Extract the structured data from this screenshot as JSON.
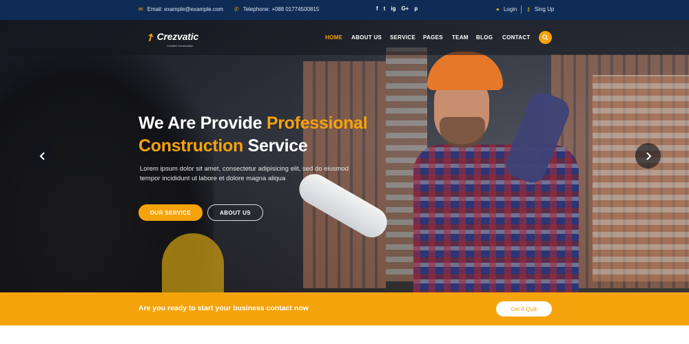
{
  "topbar": {
    "email": "Email: example@example.com",
    "phone": "Telephone: +088 01774500815",
    "social": [
      "f",
      "t",
      "ig",
      "G+",
      "p"
    ],
    "login": "Login",
    "signup": "Sing Up"
  },
  "brand": {
    "name": "Crezvatic",
    "tagline": "Creative Construction"
  },
  "nav": {
    "items": [
      "HOME",
      "ABOUT US",
      "SERVICE",
      "PAGES",
      "TEAM",
      "BLOG",
      "CONTACT"
    ],
    "active": "HOME"
  },
  "hero": {
    "title_part1": "We Are Provide ",
    "title_accent1": "Professional",
    "title_accent2": "Construction",
    "title_part2": " Service",
    "lead_line1": "Lorem ipsum dolor sit amet, consectetur adipisicing elit, sed do eiusmod",
    "lead_line2": "tempor incididunt ut labore et dolore magna aliqua",
    "primary_button": "OUR SERVICE",
    "secondary_button": "ABOUT US"
  },
  "cta": {
    "text": "Are you ready to start your business contact now",
    "button": "Get A Quik"
  },
  "colors": {
    "accent": "#f5a30b",
    "topbar": "#0e2c55",
    "white": "#ffffff"
  }
}
